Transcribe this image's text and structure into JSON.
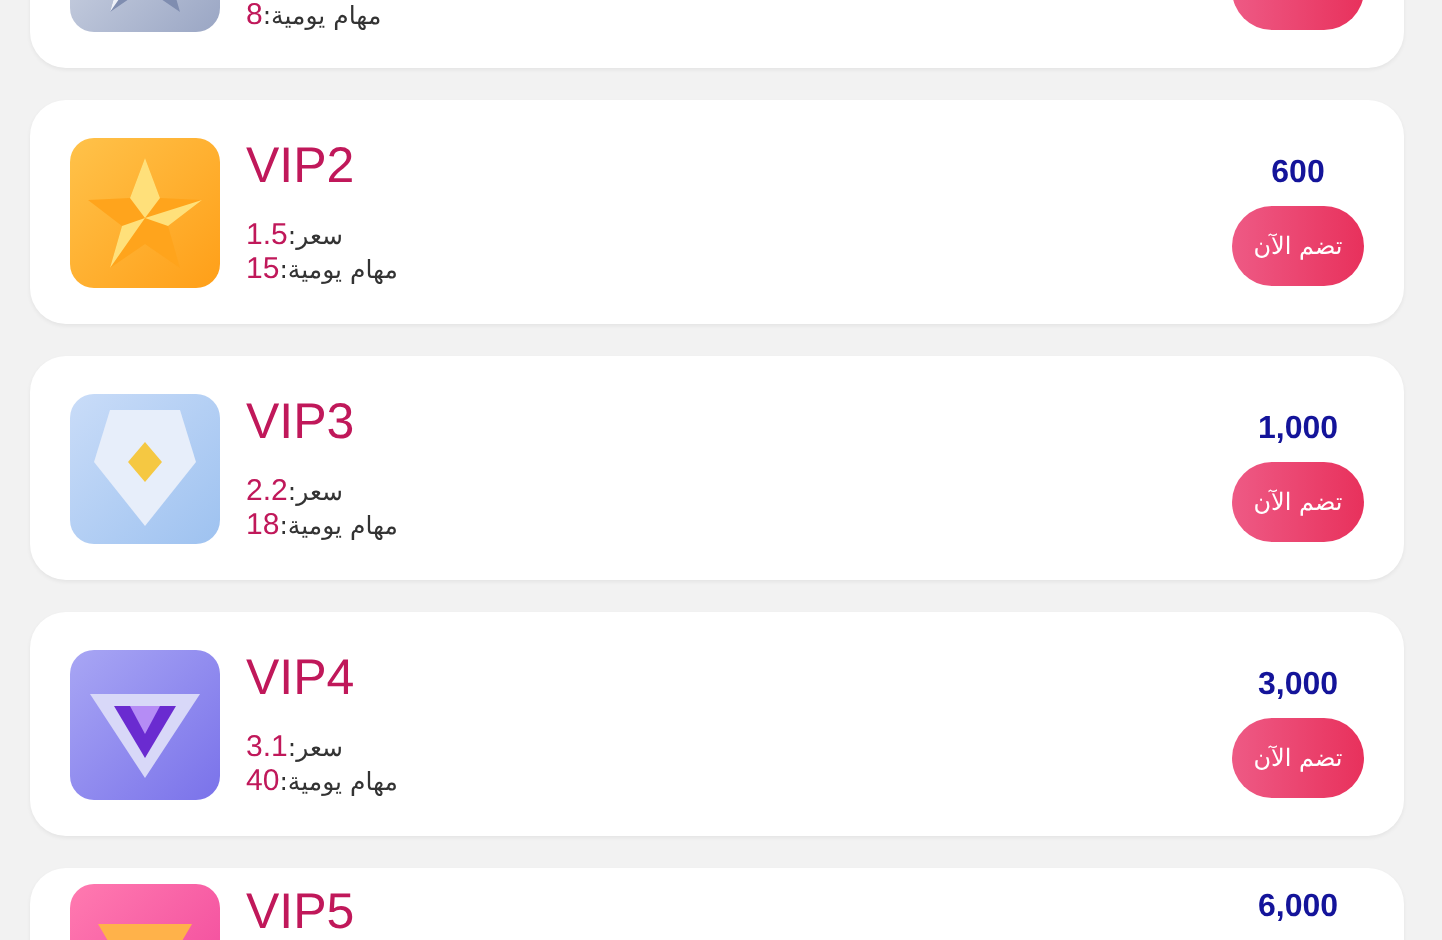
{
  "levels": [
    {
      "kind": "silver-star",
      "tasks_label": "مهام يومية:",
      "tasks": "8",
      "has_button": true
    },
    {
      "kind": "gold-star",
      "name": "VIP2",
      "rate_label": "سعر:",
      "rate": "1.5",
      "tasks_label": "مهام يومية:",
      "tasks": "15",
      "price": "600",
      "button": {
        "label": "تضم الآن"
      }
    },
    {
      "kind": "crystal",
      "name": "VIP3",
      "rate_label": "سعر:",
      "rate": "2.2",
      "tasks_label": "مهام يومية:",
      "tasks": "18",
      "price": "1,000",
      "button": {
        "label": "تضم الآن"
      }
    },
    {
      "kind": "gem",
      "name": "VIP4",
      "rate_label": "سعر:",
      "rate": "3.1",
      "tasks_label": "مهام يومية:",
      "tasks": "40",
      "price": "3,000",
      "button": {
        "label": "تضم الآن"
      }
    },
    {
      "kind": "pink",
      "name": "VIP5",
      "price": "6,000"
    }
  ]
}
